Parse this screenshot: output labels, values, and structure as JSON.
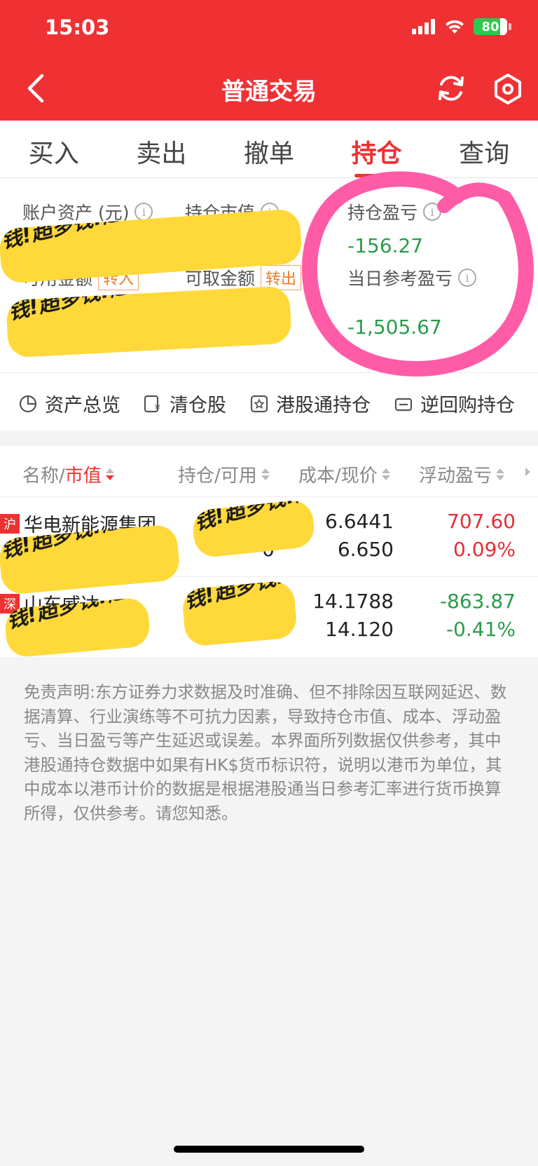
{
  "status_bar": {
    "time": "15:03",
    "battery": "80"
  },
  "nav": {
    "title": "普通交易"
  },
  "tabs": [
    {
      "label": "买入"
    },
    {
      "label": "卖出"
    },
    {
      "label": "撤单"
    },
    {
      "label": "持仓",
      "active": true
    },
    {
      "label": "查询"
    }
  ],
  "summary": {
    "account_assets_label": "账户资产 (元)",
    "market_value_label": "持仓市值",
    "position_pl_label": "持仓盈亏",
    "position_pl_value": "-156.27",
    "available_label": "可用金额",
    "transfer_in": "转入",
    "withdrawable_label": "可取金额",
    "transfer_out": "转出",
    "daily_pl_label": "当日参考盈亏",
    "daily_pl_value": "-1,505.67"
  },
  "shortcuts": [
    {
      "label": "资产总览",
      "icon": "pie-chart-icon"
    },
    {
      "label": "清仓股",
      "icon": "yuan-doc-icon"
    },
    {
      "label": "港股通持仓",
      "icon": "star-box-icon"
    },
    {
      "label": "逆回购持仓",
      "icon": "repo-icon"
    }
  ],
  "table": {
    "col_name_prefix": "名称/",
    "col_name_sort": "市值",
    "col_hold": "持仓/可用",
    "col_cost": "成本/现价",
    "col_pl": "浮动盈亏",
    "rows": [
      {
        "market": "沪",
        "name": "华电新能源集团",
        "avail": "0",
        "cost": "6.6441",
        "price": "6.650",
        "pl": "707.60",
        "pl_pct": "0.09%",
        "trend": "up"
      },
      {
        "market": "深",
        "name": "山东威达",
        "avail": "",
        "cost": "14.1788",
        "price": "14.120",
        "pl": "-863.87",
        "pl_pct": "-0.41%",
        "trend": "down"
      }
    ]
  },
  "disclaimer": "免责声明:东方证券力求数据及时准确、但不排除因互联网延迟、数据清算、行业演练等不可抗力因素，导致持仓市值、成本、浮动盈亏、当日盈亏等产生延迟或误差。本界面所列数据仅供参考，其中港股通持仓数据中如果有HK$货币标识符，说明以港币为单位，其中成本以港币计价的数据是根据港股通当日参考汇率进行货币换算所得，仅供参考。请您知悉。",
  "scribble_text": "钱!超多钱!超多钱!超多钱!超多钱!超多钱!超多钱!超多",
  "colors": {
    "brand_red": "#ef3134",
    "loss_green": "#2a9d4a",
    "gain_red": "#e52e37",
    "annotation_pink": "#ff5ca8",
    "redaction_yellow": "#ffd93a"
  }
}
